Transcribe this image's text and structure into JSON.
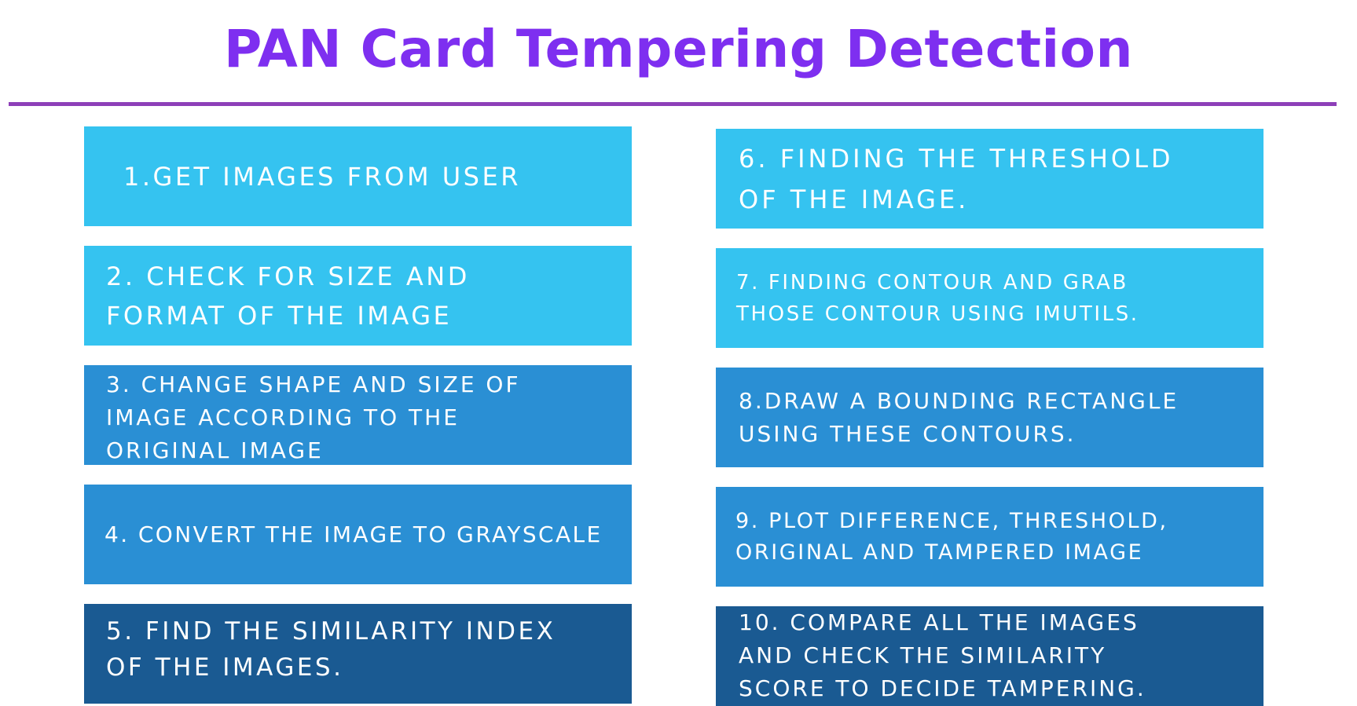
{
  "title": "PAN Card Tempering Detection",
  "colors": {
    "title": "#7e2ff0",
    "rule": "#8d3fb8",
    "light_blue": "#35c3f0",
    "medium_blue": "#2a8fd4",
    "dark_blue": "#1a5a92"
  },
  "steps": {
    "left": [
      {
        "text": "1.GET IMAGES FROM USER",
        "shade": "light_blue"
      },
      {
        "text": "2. CHECK FOR SIZE AND\nFORMAT OF THE IMAGE",
        "shade": "light_blue"
      },
      {
        "text": "3. CHANGE SHAPE AND SIZE OF\nIMAGE ACCORDING TO THE\nORIGINAL IMAGE",
        "shade": "medium_blue"
      },
      {
        "text": "4. CONVERT THE IMAGE TO GRAYSCALE",
        "shade": "medium_blue"
      },
      {
        "text": "5. FIND THE SIMILARITY INDEX\nOF THE IMAGES.",
        "shade": "dark_blue"
      }
    ],
    "right": [
      {
        "text": "6. FINDING THE THRESHOLD\nOF THE IMAGE.",
        "shade": "light_blue"
      },
      {
        "text": "7. FINDING CONTOUR AND GRAB\nTHOSE CONTOUR USING IMUTILS.",
        "shade": "light_blue"
      },
      {
        "text": "8.DRAW A BOUNDING RECTANGLE\nUSING THESE CONTOURS.",
        "shade": "medium_blue"
      },
      {
        "text": "9. PLOT DIFFERENCE, THRESHOLD,\nORIGINAL AND TAMPERED IMAGE",
        "shade": "medium_blue"
      },
      {
        "text": "10. COMPARE ALL THE IMAGES\nAND CHECK THE SIMILARITY\nSCORE TO DECIDE TAMPERING.",
        "shade": "dark_blue"
      }
    ]
  }
}
